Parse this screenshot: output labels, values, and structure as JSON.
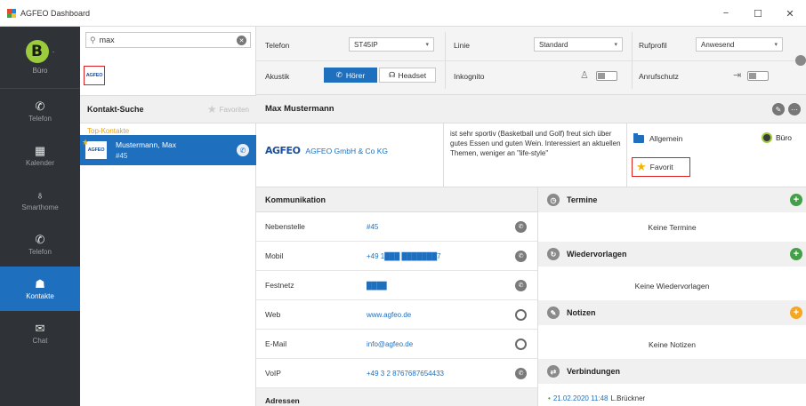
{
  "window": {
    "title": "AGFEO Dashboard",
    "min": "−",
    "max": "☐",
    "close": "✕"
  },
  "nav": {
    "avatar_letter": "B",
    "menu_dots": "·",
    "status": "Büro",
    "items": [
      {
        "label": "Telefon",
        "icon": "phone-icon",
        "glyph": "✆"
      },
      {
        "label": "Kalender",
        "icon": "calendar-icon",
        "glyph": "▦"
      },
      {
        "label": "Smarthome",
        "icon": "bulb-icon",
        "glyph": "♁"
      },
      {
        "label": "Telefon",
        "icon": "phone-icon",
        "glyph": "✆"
      },
      {
        "label": "Kontakte",
        "icon": "contacts-icon",
        "glyph": "☗",
        "active": true
      },
      {
        "label": "Chat",
        "icon": "chat-icon",
        "glyph": "✉"
      }
    ]
  },
  "search": {
    "value": "max",
    "placeholder": ""
  },
  "contacts": {
    "header": "Kontakt-Suche",
    "favorites_label": "Favoriten",
    "group": "Top-Kontakte",
    "selected": {
      "name": "Mustermann, Max",
      "ext": "#45"
    }
  },
  "toolbar": {
    "telefon_label": "Telefon",
    "telefon_value": "ST45IP",
    "linie_label": "Linie",
    "linie_value": "Standard",
    "rufprofil_label": "Rufprofil",
    "rufprofil_value": "Anwesend",
    "akustik_label": "Akustik",
    "hoerer_label": "Hörer",
    "headset_label": "Headset",
    "inkognito_label": "Inkognito",
    "anrufschutz_label": "Anrufschutz"
  },
  "contact": {
    "name": "Max Mustermann",
    "logo_text": "AGFEO",
    "company": "AGFEO GmbH & Co KG",
    "note": "ist sehr sportiv (Basketball und Golf) freut sich über gutes Essen und guten Wein. Interessiert an aktuellen Themen, weniger an \"life-style\"",
    "category": "Allgemein",
    "status": "Büro",
    "favorite": "Favorit"
  },
  "communication": {
    "title": "Kommunikation",
    "rows": [
      {
        "label": "Nebenstelle",
        "value": "#45"
      },
      {
        "label": "Mobil",
        "value": "+49 1███ ███████7"
      },
      {
        "label": "Festnetz",
        "value": "████"
      },
      {
        "label": "Web",
        "value": "www.agfeo.de"
      },
      {
        "label": "E-Mail",
        "value": "info@agfeo.de"
      },
      {
        "label": "VoIP",
        "value": "+49 3 2 8767687654433"
      }
    ],
    "next_section": "Adressen"
  },
  "panels": {
    "termine": {
      "title": "Termine",
      "empty": "Keine Termine"
    },
    "wiedervorlagen": {
      "title": "Wiedervorlagen",
      "empty": "Keine Wiedervorlagen"
    },
    "notizen": {
      "title": "Notizen",
      "empty": "Keine Notizen"
    },
    "verbindungen": {
      "title": "Verbindungen",
      "entry_time": "21.02.2020 11:48",
      "entry_who": "L.Brückner"
    }
  },
  "colors": {
    "accent": "#1f6fbf",
    "nav_bg": "#2f3236",
    "green": "#43a047",
    "orange": "#f5a623",
    "highlight": "#e02020"
  }
}
